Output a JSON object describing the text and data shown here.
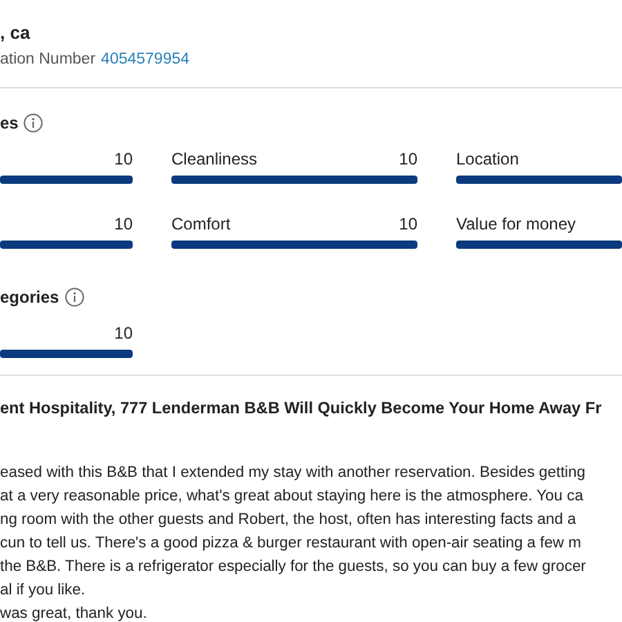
{
  "property": {
    "title": ", ca",
    "confirmation_label": "ation Number",
    "confirmation_number": "4054579954"
  },
  "score_sections": [
    {
      "heading": "es",
      "items": [
        {
          "score": "10",
          "level": 1
        },
        {
          "label": "Cleanliness",
          "score": "10",
          "level": 1
        },
        {
          "label": "Location",
          "level": 1
        },
        {
          "score": "10",
          "level": 1
        },
        {
          "label": "Comfort",
          "score": "10",
          "level": 1
        },
        {
          "label": "Value for money",
          "level": 1
        }
      ]
    },
    {
      "heading": "egories",
      "items": [
        {
          "score": "10",
          "level": 1
        }
      ]
    }
  ],
  "review": {
    "title": "ent Hospitality, 777 Lenderman B&B Will Quickly Become Your Home Away Fr",
    "lines": [
      "eased with this B&B that I extended my stay with another reservation. Besides getting",
      "at a very reasonable price, what's great about staying here is the atmosphere. You ca",
      "ng room with the other guests and Robert, the host, often has interesting facts and a",
      "cun to tell us. There's a good pizza & burger restaurant with open-air seating a few m",
      "the B&B. There is a refrigerator especially for the guests, so you can buy a few grocer",
      "al if you like.",
      "was great, thank you."
    ]
  }
}
